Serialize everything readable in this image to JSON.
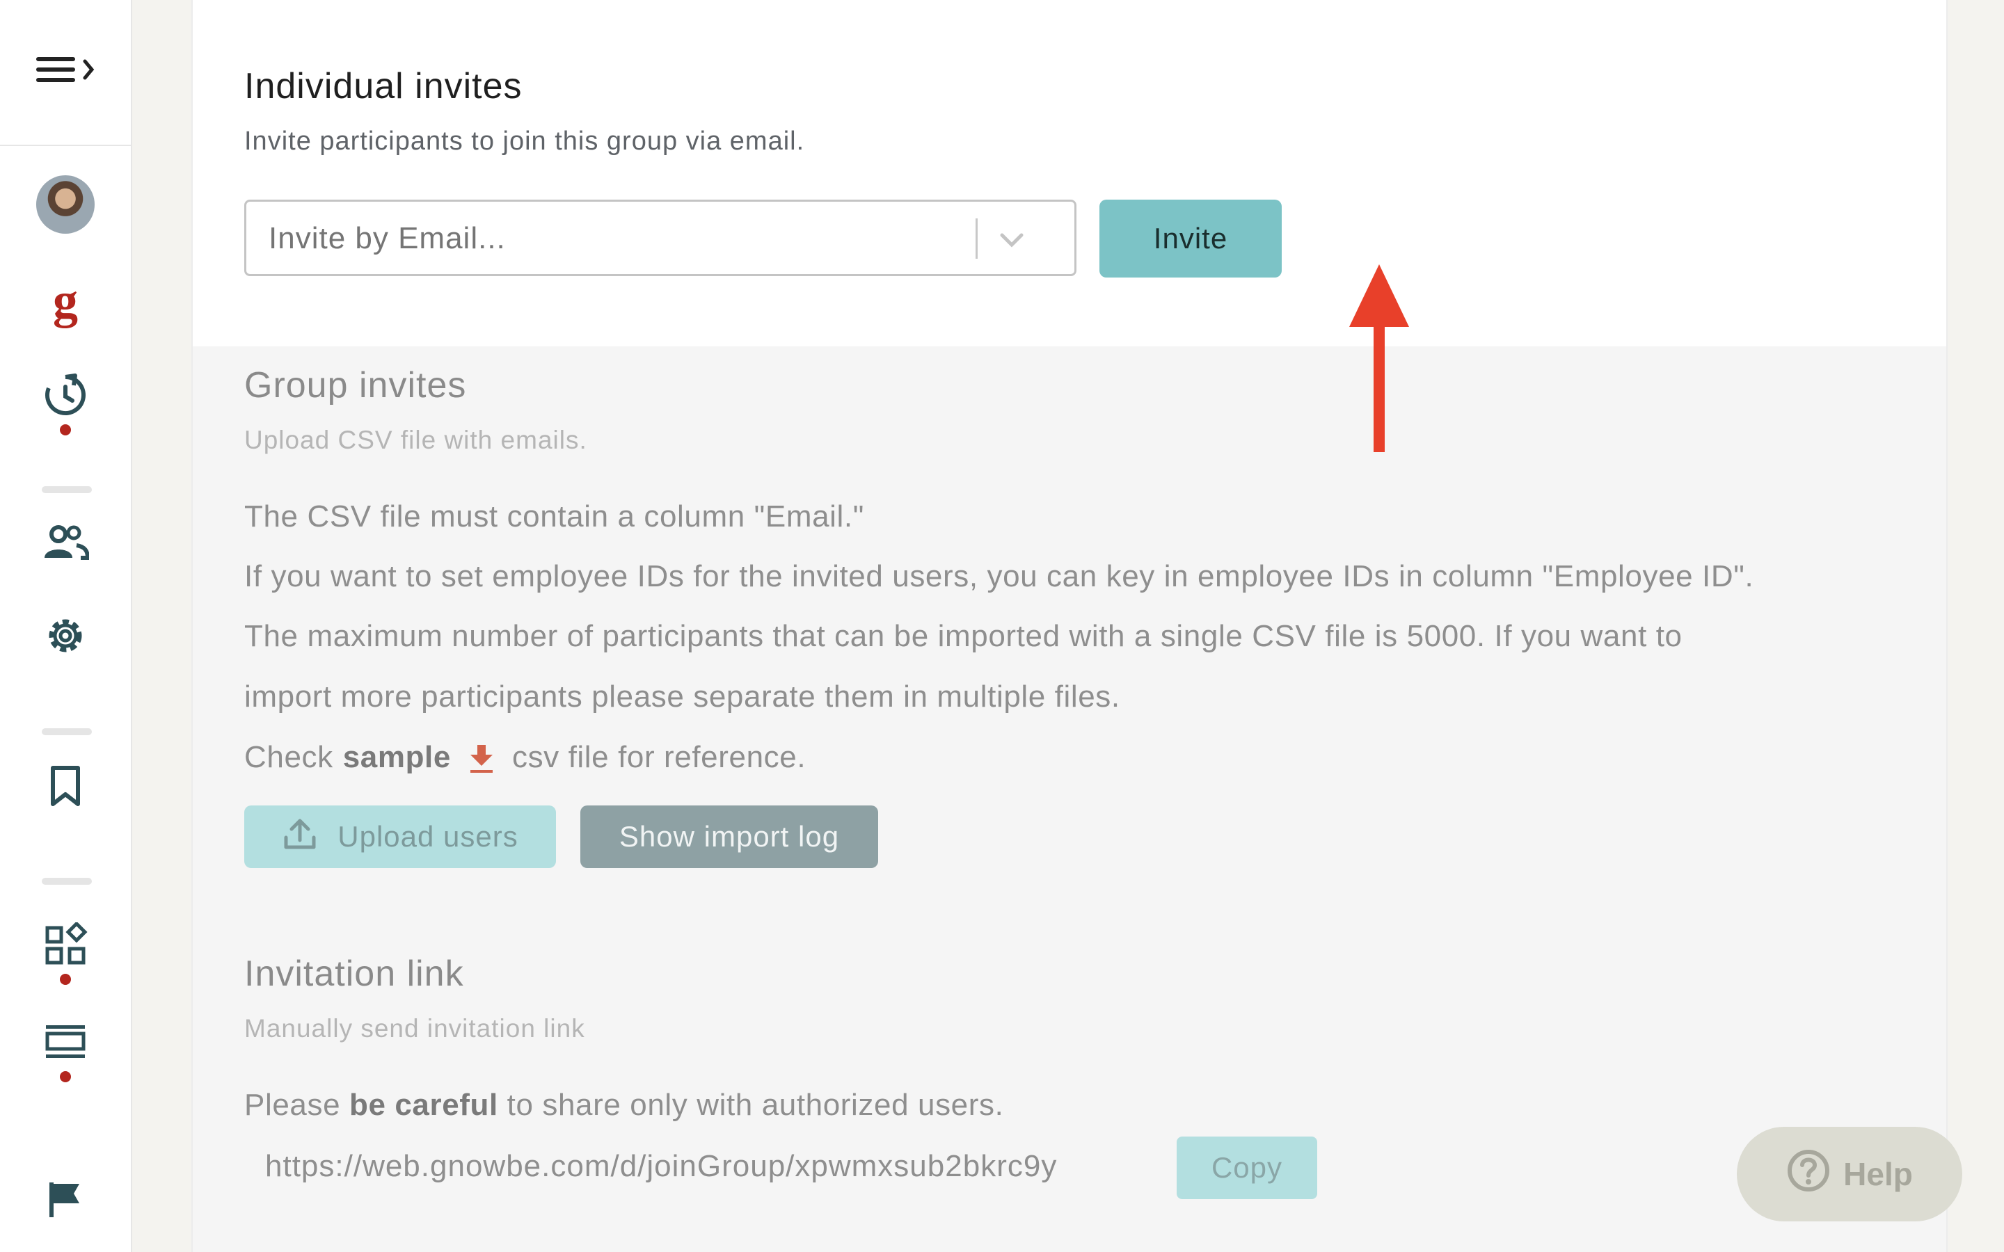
{
  "individual": {
    "title": "Individual invites",
    "subtitle": "Invite participants to join this group via email.",
    "email_placeholder": "Invite by Email...",
    "invite_label": "Invite"
  },
  "group": {
    "title": "Group invites",
    "subtitle": "Upload CSV file with emails.",
    "line1": "The CSV file must contain a column \"Email.\"",
    "line2": "If you want to set employee IDs for the invited users, you can key in employee IDs in column \"Employee ID\".",
    "line3": "The maximum number of participants that can be imported with a single CSV file is 5000. If you want to",
    "line4": "import more participants please separate them in multiple files.",
    "check_prefix": "Check",
    "check_sample": "sample",
    "check_suffix": "csv file for reference.",
    "upload_label": "Upload users",
    "log_label": "Show import log"
  },
  "link": {
    "title": "Invitation link",
    "subtitle": "Manually send invitation link",
    "warn_prefix": "Please",
    "warn_bold": "be careful",
    "warn_suffix": "to share only with authorized users.",
    "url": "https://web.gnowbe.com/d/joinGroup/xpwmxsub2bkrc9y",
    "copy_label": "Copy"
  },
  "help": {
    "label": "Help"
  },
  "sidebar": {
    "logo_letter": "g",
    "icons": [
      "menu-expand-icon",
      "avatar",
      "gnowbe-logo",
      "history-icon",
      "people-icon",
      "gear-icon",
      "bookmark-icon",
      "widgets-icon",
      "list-view-icon",
      "flag-icon"
    ]
  },
  "colors": {
    "accent": "#7cc3c6",
    "alert_dot": "#b3261e",
    "arrow": "#e8402a"
  }
}
